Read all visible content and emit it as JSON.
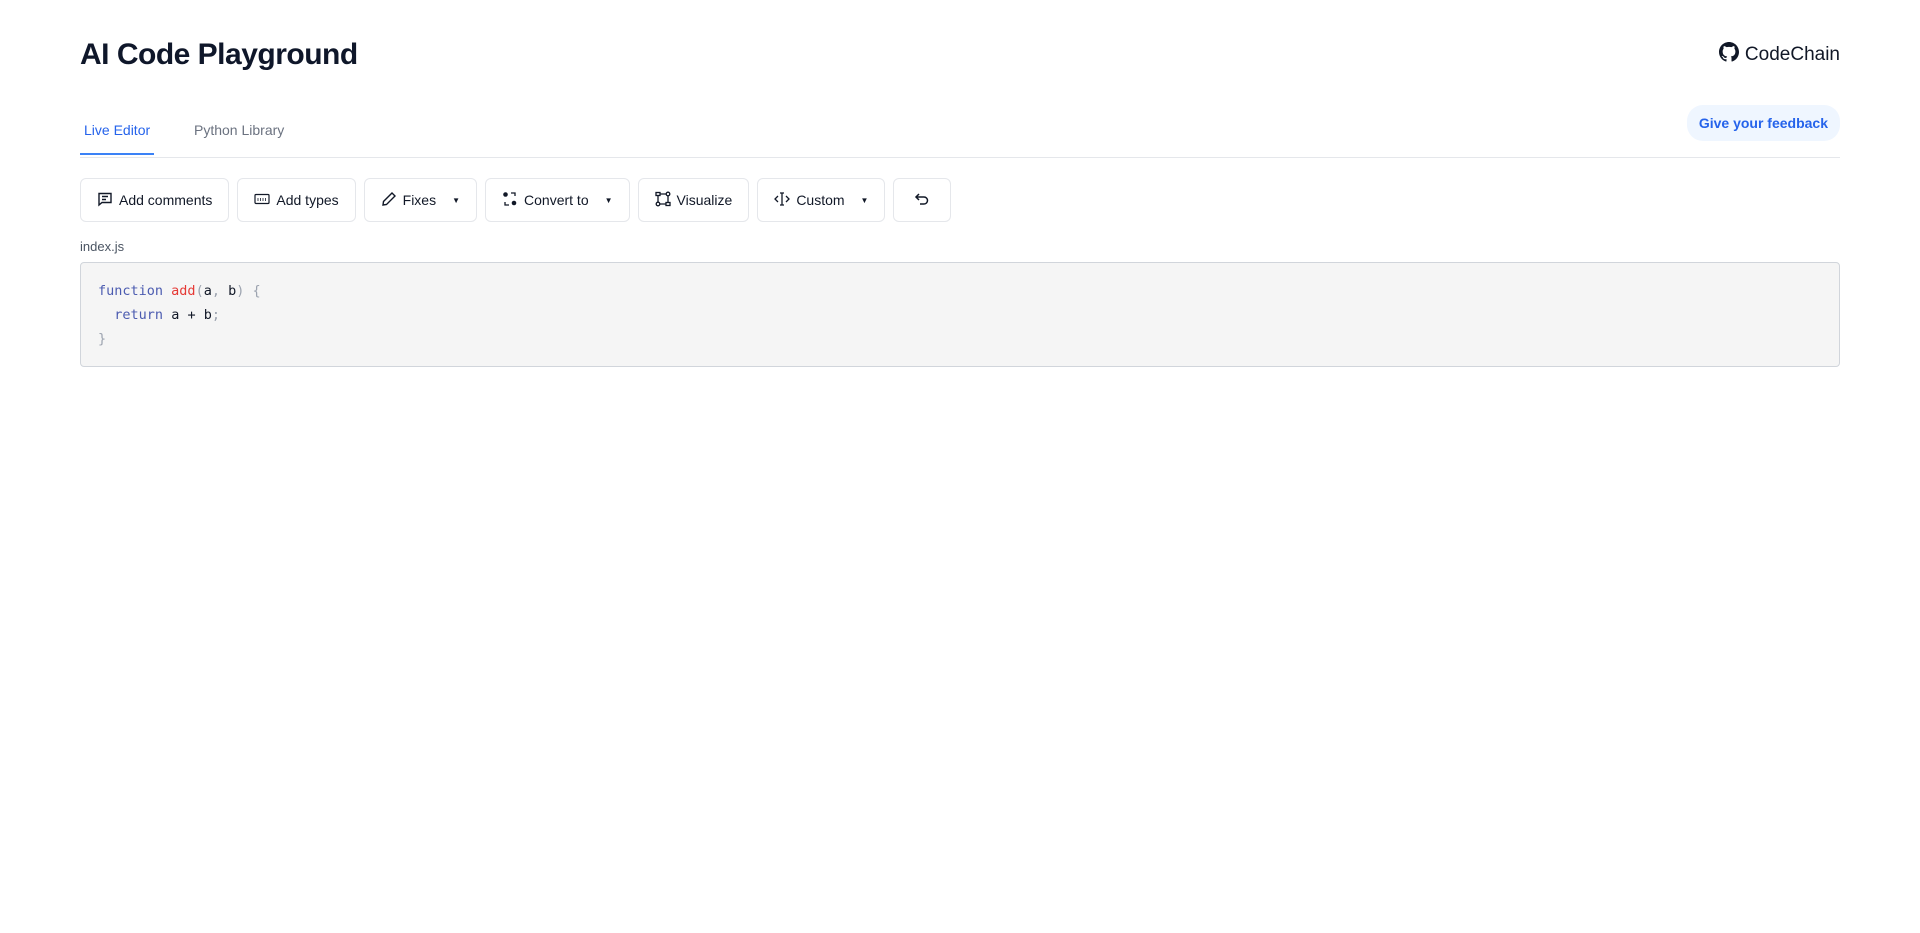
{
  "header": {
    "title": "AI Code Playground",
    "brand_label": "CodeChain",
    "brand_icon": "github-icon"
  },
  "tabs": [
    {
      "label": "Live Editor",
      "active": true
    },
    {
      "label": "Python Library",
      "active": false
    }
  ],
  "feedback_label": "Give your feedback",
  "toolbar": {
    "add_comments": "Add comments",
    "add_types": "Add types",
    "fixes": "Fixes",
    "convert_to": "Convert to",
    "visualize": "Visualize",
    "custom": "Custom",
    "undo_icon": "undo-icon"
  },
  "editor": {
    "filename": "index.js",
    "code": {
      "l1_kw": "function",
      "l1_fn": "add",
      "l1_open": "(",
      "l1_a": "a",
      "l1_comma": ",",
      "l1_b": "b",
      "l1_close": ")",
      "l1_brace": "{",
      "l2_kw": "return",
      "l2_expr": "a + b",
      "l2_semi": ";",
      "l3_brace": "}"
    }
  },
  "colors": {
    "accent": "#2563eb",
    "keyword": "#4b5bb0",
    "function_name": "#e53935"
  }
}
